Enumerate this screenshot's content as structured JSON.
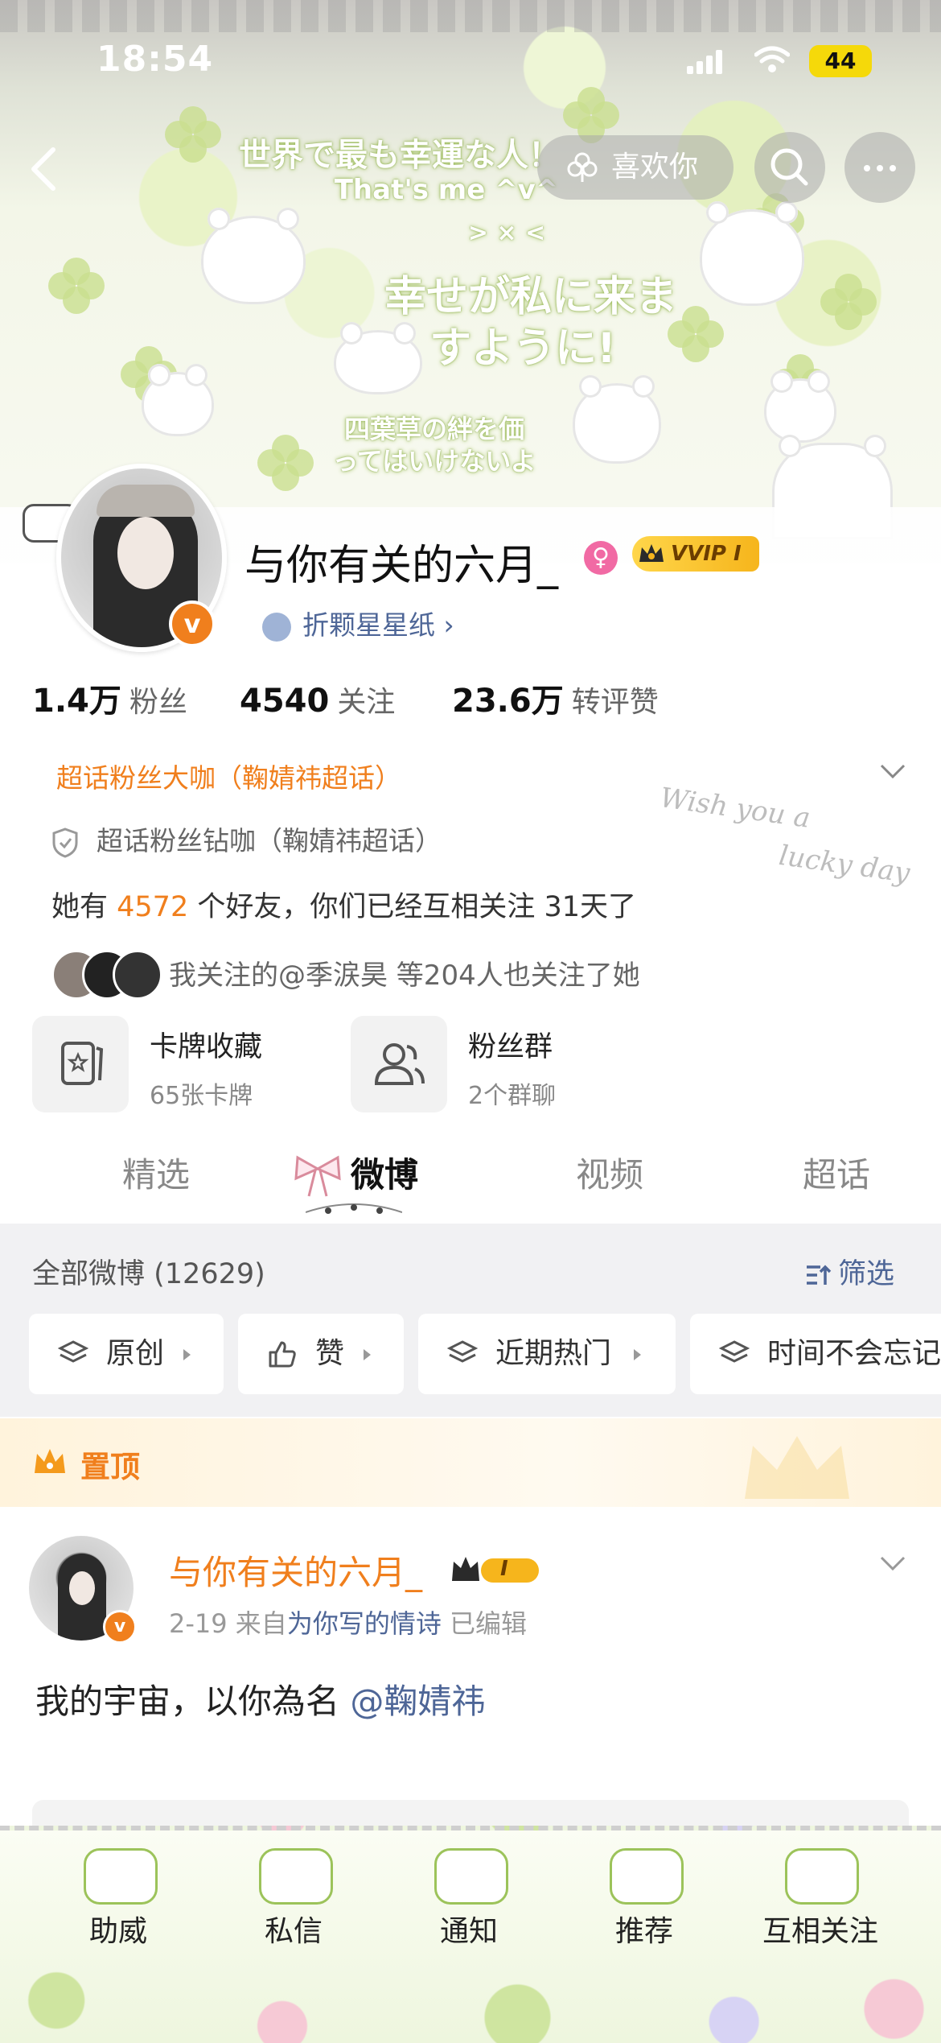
{
  "status_bar": {
    "time": "18:54",
    "battery": "44"
  },
  "banner": {
    "text_lines": [
      "世界で最も幸運な人！",
      "That's me ^v^",
      "> × <",
      "幸せが私に来ま",
      "すように!",
      "四葉草の絆を価",
      "ってはいけないよ"
    ]
  },
  "header": {
    "like_label": "喜欢你"
  },
  "profile": {
    "name": "与你有关的六月_",
    "v_badge": "v",
    "gender_symbol": "♀",
    "vip_label": "VVIP I",
    "star_paper": "折颗星星纸 ›",
    "stats": [
      {
        "value": "1.4万",
        "label": "粉丝"
      },
      {
        "value": "4540",
        "label": "关注"
      },
      {
        "value": "23.6万",
        "label": "转评赞"
      }
    ],
    "supertopic_primary": "超话粉丝大咖（鞠婧祎超话）",
    "supertopic_secondary": "超话粉丝钻咖（鞠婧祎超话）",
    "friends_prefix": "她有 ",
    "friends_count": "4572",
    "friends_suffix": " 个好友，你们已经互相关注 31天了",
    "mutual_text": "我关注的@季涙昊 等204人也关注了她",
    "cards": [
      {
        "title": "卡牌收藏",
        "sub": "65张卡牌"
      },
      {
        "title": "粉丝群",
        "sub": "2个群聊"
      }
    ]
  },
  "decor_text": {
    "wish_1": "Wish you a",
    "wish_2": "lucky day"
  },
  "tabs": [
    "精选",
    "微博",
    "视频",
    "超话"
  ],
  "filter": {
    "all_count": "全部微博 (12629)",
    "filter_label": "筛选",
    "chips": [
      "原创",
      "赞",
      "近期热门",
      "时间不会忘记"
    ]
  },
  "pinned": {
    "label": "置顶"
  },
  "post": {
    "author": "与你有关的六月_",
    "vip_label": "I",
    "date": "2-19",
    "from_prefix": " 来自",
    "source": "为你写的情诗",
    "edited": " 已编辑",
    "text": "我的宇宙，以你為名 ",
    "mention": "@鞠婧祎"
  },
  "bottom_nav": [
    "助威",
    "私信",
    "通知",
    "推荐",
    "互相关注"
  ],
  "colors": {
    "accent_orange": "#f07f1d",
    "link_blue": "#4e6697",
    "vip_gold": "#f6b51c",
    "clover_green": "#c9df8e"
  }
}
